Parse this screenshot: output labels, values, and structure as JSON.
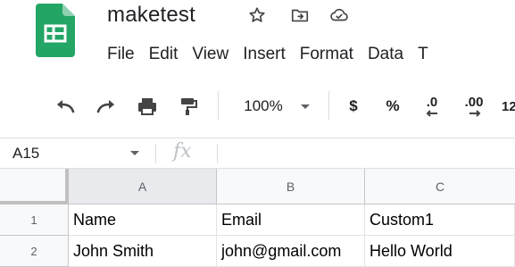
{
  "document": {
    "title": "maketest"
  },
  "title_icons": [
    "star-icon",
    "move-to-folder-icon",
    "cloud-status-icon"
  ],
  "menu": [
    "File",
    "Edit",
    "View",
    "Insert",
    "Format",
    "Data",
    "T"
  ],
  "toolbar": {
    "zoom": "100%",
    "currency_label": "$",
    "percent_label": "%",
    "decrease_decimal_label": ".0",
    "increase_decimal_label": ".00",
    "more_formats_label": "12"
  },
  "formula_bar": {
    "cell_ref": "A15",
    "fx_label": "fx",
    "content": ""
  },
  "grid": {
    "columns": [
      "A",
      "B",
      "C"
    ],
    "selected_column": "A",
    "rows": [
      {
        "number": "1",
        "cells": [
          "Name",
          "Email",
          "Custom1"
        ]
      },
      {
        "number": "2",
        "cells": [
          "John Smith",
          "john@gmail.com",
          "Hello World"
        ]
      }
    ]
  },
  "colors": {
    "sheets_green": "#23a566",
    "header_bg": "#f8f9fa",
    "selected_header_bg": "#e8eaed",
    "gridline": "#e2e3e3"
  }
}
